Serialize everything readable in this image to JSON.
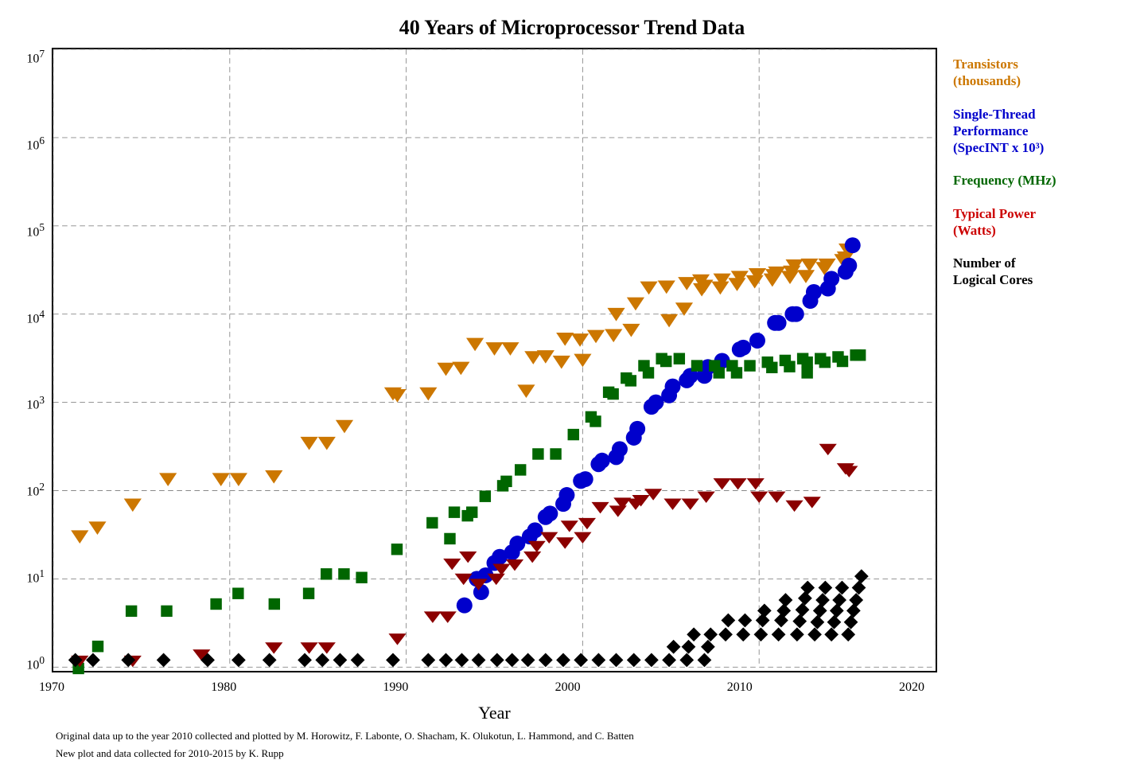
{
  "title": "40 Years of Microprocessor Trend Data",
  "xAxis": {
    "label": "Year",
    "ticks": [
      "1970",
      "1980",
      "1990",
      "2000",
      "2010",
      "2020"
    ]
  },
  "yAxis": {
    "ticks": [
      "10⁷",
      "10⁶",
      "10⁵",
      "10⁴",
      "10³",
      "10²",
      "10¹",
      "10⁰"
    ]
  },
  "legend": [
    {
      "label": "Transistors\n(thousands)",
      "color": "orange",
      "colorHex": "#CC7700"
    },
    {
      "label": "Single-Thread\nPerformance\n(SpecINT x 10³)",
      "color": "blue",
      "colorHex": "#0000CC"
    },
    {
      "label": "Frequency (MHz)",
      "color": "green",
      "colorHex": "#006600"
    },
    {
      "label": "Typical Power\n(Watts)",
      "color": "red",
      "colorHex": "#CC0000"
    },
    {
      "label": "Number of\nLogical Cores",
      "color": "black",
      "colorHex": "#000000"
    }
  ],
  "footnote1": "Original data up to the year 2010 collected and plotted by M. Horowitz, F. Labonte, O. Shacham, K. Olukotun, L. Hammond, and C. Batten",
  "footnote2": "New plot and data collected for 2010-2015 by K. Rupp"
}
